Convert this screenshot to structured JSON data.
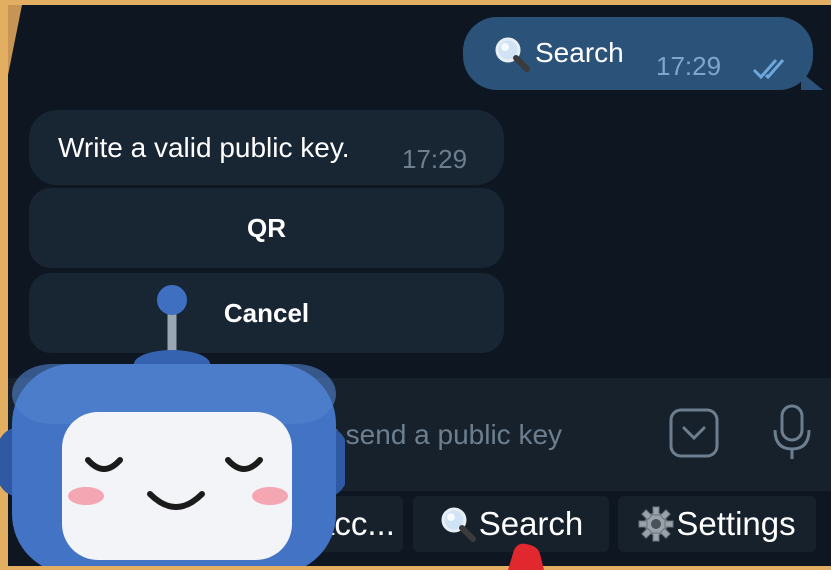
{
  "messages": {
    "outgoing": {
      "text": "Search",
      "time": "17:29",
      "status_icon": "double-check-icon"
    },
    "incoming": {
      "text": "Write a valid public key.",
      "time": "17:29"
    }
  },
  "inline_keyboard": {
    "qr_label": "QR",
    "cancel_label": "Cancel"
  },
  "composer": {
    "placeholder": "or send a public key"
  },
  "reply_keyboard": {
    "account_label": "acc...",
    "search_label": "Search",
    "settings_label": "Settings"
  },
  "colors": {
    "chat_bg": "#0e1621",
    "outgoing_bubble": "#2b5278",
    "incoming_bubble": "#182533",
    "panel": "#17212b",
    "frame": "#e2ae62"
  }
}
